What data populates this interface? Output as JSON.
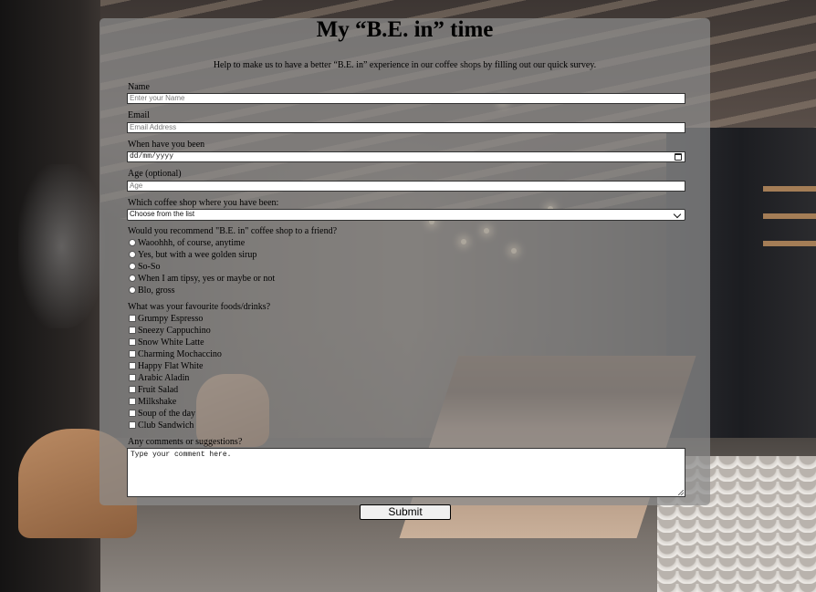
{
  "form": {
    "title": "My “B.E. in” time",
    "intro": "Help to make us to have a better “B.E. in” experience in our coffee shops by filling out our quick survey.",
    "name_label": "Name",
    "name_placeholder": "Enter your Name",
    "email_label": "Email",
    "email_placeholder": "Email Address",
    "date_label": "When have you been",
    "date_placeholder": "dd/mm/yyyy",
    "age_label": "Age (optional)",
    "age_placeholder": "Age",
    "shop_label": "Which coffee shop where you have been:",
    "shop_selected": "Choose from the list",
    "recommend_label": "Would you recommend \"B.E. in\" coffee shop to a friend?",
    "recommend_options": [
      "Waoohhh, of course, anytime",
      "Yes, but with a wee golden sirup",
      "So-So",
      "When I am tipsy, yes or maybe or not",
      "Blo, gross"
    ],
    "favourites_label": "What was your favourite foods/drinks?",
    "favourites_options": [
      "Grumpy Espresso",
      "Sneezy Cappuchino",
      "Snow White Latte",
      "Charming Mochaccino",
      "Happy Flat White",
      "Arabic Aladin",
      "Fruit Salad",
      "Milkshake",
      "Soup of the day",
      "Club Sandwich"
    ],
    "comments_label": "Any comments or suggestions?",
    "comments_value": "Type your comment here.",
    "submit_label": "Submit"
  },
  "icons": {
    "date": "calendar-icon",
    "select": "chevron-down-icon"
  }
}
